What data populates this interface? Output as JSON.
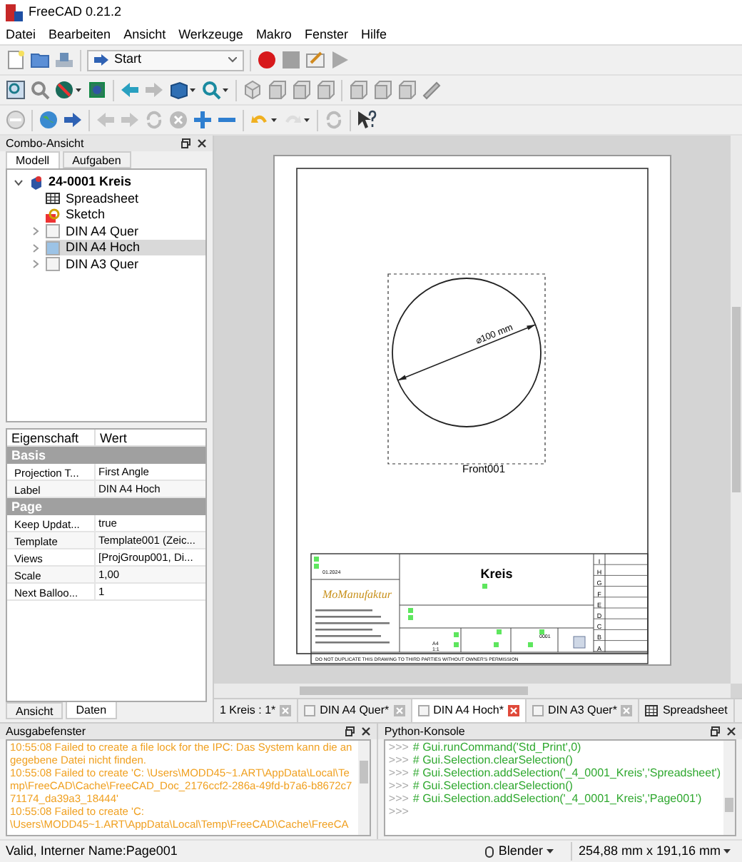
{
  "window": {
    "title": "FreeCAD 0.21.2"
  },
  "menu": [
    "Datei",
    "Bearbeiten",
    "Ansicht",
    "Werkzeuge",
    "Makro",
    "Fenster",
    "Hilfe"
  ],
  "workbench": "Start",
  "combo": {
    "title": "Combo-Ansicht",
    "tabs": [
      {
        "label": "Modell",
        "selected": true
      },
      {
        "label": "Aufgaben",
        "selected": false
      }
    ],
    "tree": [
      {
        "label": "24-0001 Kreis",
        "kind": "document",
        "expanded": true,
        "selected": false,
        "children": [
          {
            "label": "Spreadsheet",
            "kind": "spreadsheet",
            "selected": false
          },
          {
            "label": "Sketch",
            "kind": "sketch",
            "selected": false
          },
          {
            "label": "DIN A4 Quer",
            "kind": "page",
            "expanded": false,
            "selected": false
          },
          {
            "label": "DIN A4 Hoch",
            "kind": "page",
            "expanded": false,
            "selected": true
          },
          {
            "label": "DIN A3 Quer",
            "kind": "page",
            "expanded": false,
            "selected": false
          }
        ]
      }
    ]
  },
  "properties": {
    "columns": [
      "Eigenschaft",
      "Wert"
    ],
    "groups": [
      {
        "name": "Basis",
        "rows": [
          {
            "name": "Projection T...",
            "value": "First Angle"
          },
          {
            "name": "Label",
            "value": "DIN A4 Hoch"
          }
        ]
      },
      {
        "name": "Page",
        "rows": [
          {
            "name": "Keep Updat...",
            "value": "true"
          },
          {
            "name": "Template",
            "value": "Template001 (Zeic..."
          },
          {
            "name": "Views",
            "value": "[ProjGroup001, Di..."
          },
          {
            "name": "Scale",
            "value": "1,00"
          },
          {
            "name": "Next Balloo...",
            "value": "1"
          }
        ]
      }
    ],
    "tabs": [
      {
        "label": "Ansicht",
        "selected": false
      },
      {
        "label": "Daten",
        "selected": true
      }
    ]
  },
  "drawing": {
    "dimension": "⌀100 mm",
    "view_label": "Front001",
    "title": "Kreis",
    "date": "01.2024",
    "logo": "MoManufaktur",
    "format": "A4",
    "scale": "1:1",
    "number": "0001",
    "zones": [
      "I",
      "H",
      "G",
      "F",
      "E",
      "D",
      "C",
      "B",
      "A"
    ],
    "notice": "DO NOT DUPLICATE THIS DRAWING TO THIRD PARTIES WITHOUT OWNER'S PERMISSION"
  },
  "doc_tabs": [
    {
      "label": "1 Kreis : 1*",
      "kind": "model",
      "selected": false
    },
    {
      "label": "DIN A4 Quer*",
      "kind": "page",
      "selected": false
    },
    {
      "label": "DIN A4 Hoch*",
      "kind": "page",
      "selected": true
    },
    {
      "label": "DIN A3 Quer*",
      "kind": "page",
      "selected": false
    },
    {
      "label": "Spreadsheet",
      "kind": "spreadsheet",
      "selected": false
    }
  ],
  "output": {
    "title": "Ausgabefenster",
    "lines": [
      "10:55:08  Failed to create a file lock for the IPC: Das System kann die angegebene Datei nicht finden.",
      "10:55:08  Failed to create 'C: \\Users\\MODD45~1.ART\\AppData\\Local\\Temp\\FreeCAD\\Cache\\FreeCAD_Doc_2176ccf2-286a-49fd-b7a6-b8672c771174_da39a3_18444'",
      "10:55:08  Failed to create 'C:",
      "\\Users\\MODD45~1.ART\\AppData\\Local\\Temp\\FreeCAD\\Cache\\FreeCA"
    ]
  },
  "console": {
    "title": "Python-Konsole",
    "prompt": ">>>",
    "lines": [
      "# Gui.runCommand('Std_Print',0)",
      "# Gui.Selection.clearSelection()",
      "# Gui.Selection.addSelection('_4_0001_Kreis','Spreadsheet')",
      "# Gui.Selection.clearSelection()",
      "# Gui.Selection.addSelection('_4_0001_Kreis','Page001')"
    ]
  },
  "status": {
    "message": "Valid, Interner Name:Page001",
    "navigation": "Blender",
    "size": "254,88 mm x 191,16 mm"
  }
}
